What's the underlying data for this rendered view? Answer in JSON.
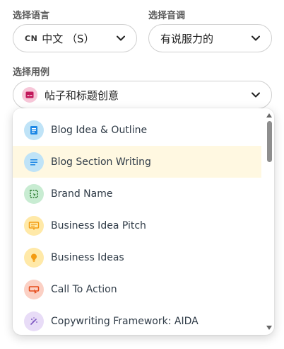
{
  "language": {
    "label": "选择语言",
    "tag": "CN",
    "value": "中文 （S）"
  },
  "tone": {
    "label": "选择音调",
    "value": "有说服力的"
  },
  "usecase": {
    "label": "选择用例",
    "value": "帖子和标题创意",
    "icon_color": "#f7c6d8",
    "icon_fg": "#c2185b"
  },
  "dropdown": {
    "items": [
      {
        "label": "Blog Idea & Outline",
        "icon": "document-icon",
        "bg": "#bfe3f7",
        "fg": "#1e88e5",
        "active": false
      },
      {
        "label": "Blog Section Writing",
        "icon": "lines-icon",
        "bg": "#bfe3f7",
        "fg": "#1e88e5",
        "active": true
      },
      {
        "label": "Brand Name",
        "icon": "dashed-square-icon",
        "bg": "#c8ecd2",
        "fg": "#2e7d32",
        "active": false
      },
      {
        "label": "Business Idea Pitch",
        "icon": "presentation-icon",
        "bg": "#ffe9a8",
        "fg": "#f39c12",
        "active": false
      },
      {
        "label": "Business Ideas",
        "icon": "lightbulb-icon",
        "bg": "#ffe9a8",
        "fg": "#f39c12",
        "active": false
      },
      {
        "label": "Call To Action",
        "icon": "click-icon",
        "bg": "#fbd0c4",
        "fg": "#e64a19",
        "active": false
      },
      {
        "label": "Copywriting Framework: AIDA",
        "icon": "sparkle-pen-icon",
        "bg": "#e8dcf7",
        "fg": "#7e57c2",
        "active": false
      }
    ]
  }
}
